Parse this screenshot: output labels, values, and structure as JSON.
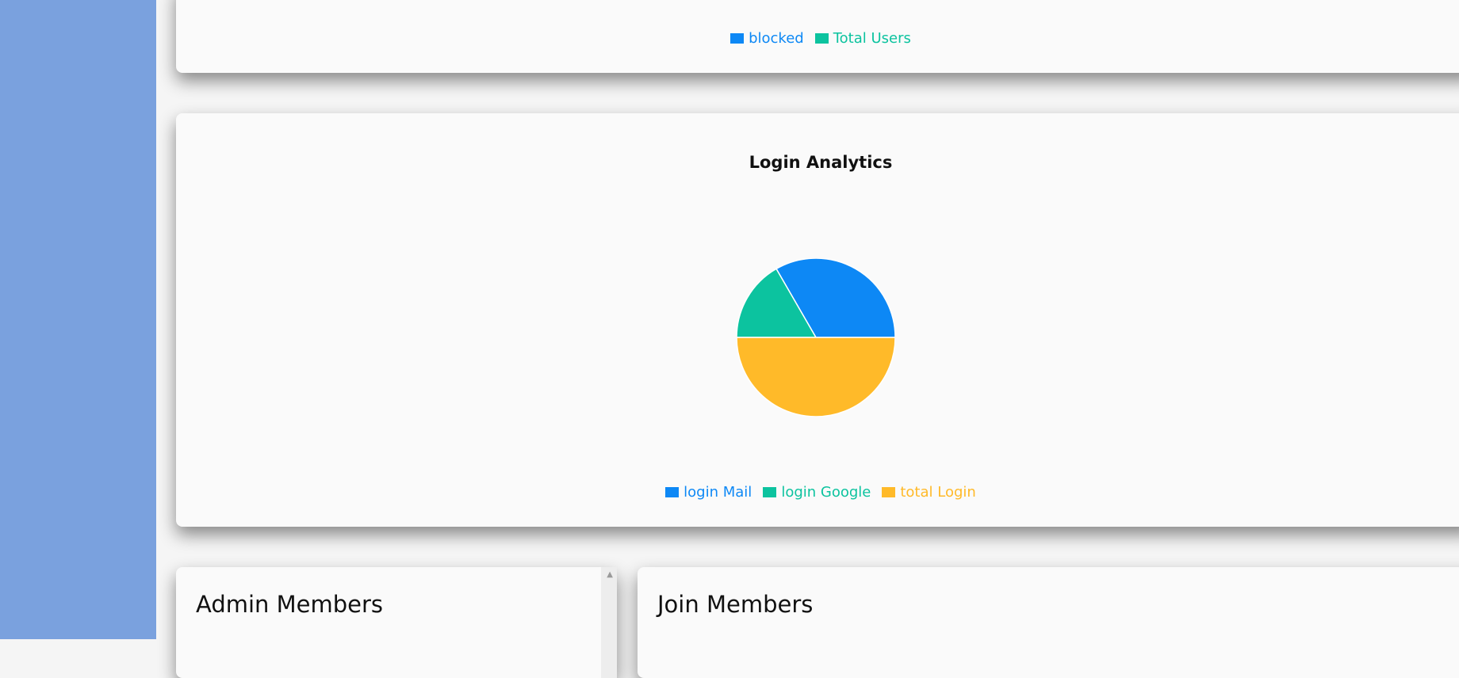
{
  "colors": {
    "sidebar": "#7aa1de",
    "blue": "#0d88f5",
    "green": "#0cc39f",
    "yellow": "#ffba29"
  },
  "users_chart": {
    "legend": [
      {
        "label": "blocked",
        "color": "#0d88f5"
      },
      {
        "label": "Total Users",
        "color": "#0cc39f"
      }
    ]
  },
  "chart_data": {
    "type": "pie",
    "title": "Login Analytics",
    "categories": [
      "login Mail",
      "login Google",
      "total Login"
    ],
    "values": [
      2,
      1,
      3
    ],
    "colors": [
      "#0d88f5",
      "#0cc39f",
      "#ffba29"
    ],
    "legend_position": "bottom"
  },
  "admin_members": {
    "title": "Admin Members",
    "scroll_icon": "scroll-up-arrow"
  },
  "join_members": {
    "title": "Join Members"
  }
}
